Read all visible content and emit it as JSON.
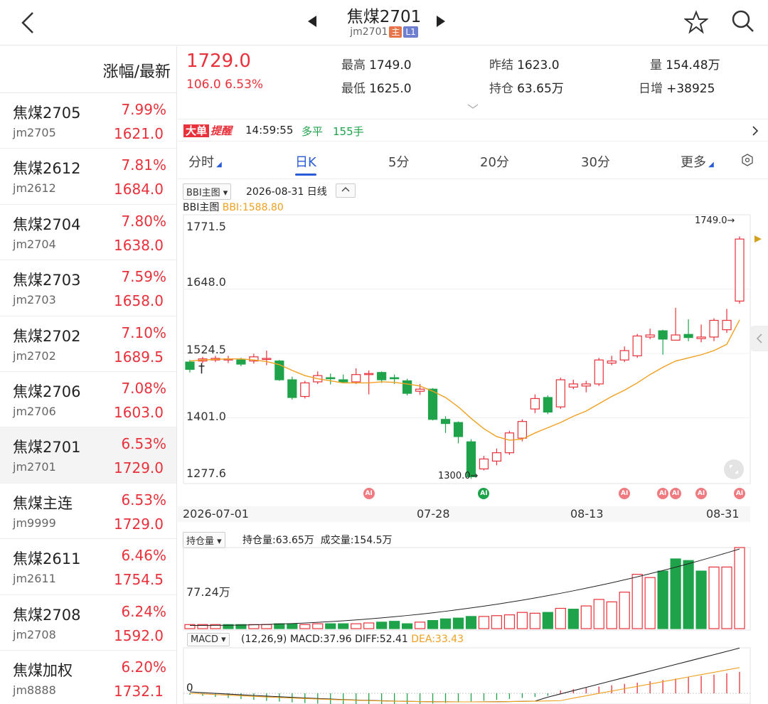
{
  "header": {
    "title": "焦煤2701",
    "code": "jm2701",
    "badge_main": "主",
    "badge_l1": "L1"
  },
  "list": {
    "header": "涨幅/最新",
    "items": [
      {
        "name": "焦煤2705",
        "code": "jm2705",
        "pct": "7.99%",
        "price": "1621.0"
      },
      {
        "name": "焦煤2612",
        "code": "jm2612",
        "pct": "7.81%",
        "price": "1684.0"
      },
      {
        "name": "焦煤2704",
        "code": "jm2704",
        "pct": "7.80%",
        "price": "1638.0"
      },
      {
        "name": "焦煤2703",
        "code": "jm2703",
        "pct": "7.59%",
        "price": "1658.0"
      },
      {
        "name": "焦煤2702",
        "code": "jm2702",
        "pct": "7.10%",
        "price": "1689.5"
      },
      {
        "name": "焦煤2706",
        "code": "jm2706",
        "pct": "7.08%",
        "price": "1603.0"
      },
      {
        "name": "焦煤2701",
        "code": "jm2701",
        "pct": "6.53%",
        "price": "1729.0"
      },
      {
        "name": "焦煤主连",
        "code": "jm9999",
        "pct": "6.53%",
        "price": "1729.0"
      },
      {
        "name": "焦煤2611",
        "code": "jm2611",
        "pct": "6.46%",
        "price": "1754.5"
      },
      {
        "name": "焦煤2708",
        "code": "jm2708",
        "pct": "6.24%",
        "price": "1592.0"
      },
      {
        "name": "焦煤加权",
        "code": "jm8888",
        "pct": "6.20%",
        "price": "1732.1"
      }
    ]
  },
  "quote": {
    "last": "1729.0",
    "change": "106.0",
    "change_pct": "6.53%",
    "high_label": "最高",
    "high": "1749.0",
    "low_label": "最低",
    "low": "1625.0",
    "prev_settle_label": "昨结",
    "prev_settle": "1623.0",
    "oi_label": "持仓",
    "oi": "63.65万",
    "vol_label": "量",
    "vol": "154.48万",
    "daily_inc_label": "日增",
    "daily_inc": "+38925"
  },
  "alert": {
    "tag1": "大单",
    "tag2": "提醒",
    "time": "14:59:55",
    "type": "多平",
    "qty": "155手"
  },
  "tabs": [
    "分时",
    "日K",
    "5分",
    "20分",
    "30分",
    "更多"
  ],
  "active_tab": 1,
  "colors": {
    "up": "#e8313a",
    "down": "#1ea34a",
    "ma": "#f0a020",
    "accent": "#2a5bd7"
  },
  "main_chart": {
    "indicator_select": "BBI主图",
    "date_label": "2026-08-31 日线",
    "legend_name": "BBI主图",
    "bbi_label": "BBI:1588.80",
    "yticks": [
      "1771.5",
      "1648.0",
      "1524.5",
      "1401.0",
      "1277.6"
    ],
    "max_marker": "1749.0",
    "min_marker": "1300.0",
    "xticks": [
      "2026-07-01",
      "07-28",
      "08-13",
      "08-31"
    ],
    "ai_label": "AI"
  },
  "oi_chart": {
    "indicator_select": "持仓量",
    "oi_label": "持仓量:63.65万",
    "vol_label": "成交量:154.5万",
    "ytick": "77.24万"
  },
  "macd_chart": {
    "indicator_select": "MACD",
    "params": "(12,26,9)",
    "macd": "MACD:37.96",
    "diff": "DIFF:52.41",
    "dea": "DEA:33.43",
    "zero_label": "0"
  },
  "chart_data": [
    {
      "type": "candlestick",
      "title": "焦煤2701 日K",
      "ylim": [
        1277.6,
        1771.5
      ],
      "x_first": "2026-07-01",
      "x_last": "2026-08-31",
      "candles": [
        {
          "o": 1508,
          "c": 1494,
          "h": 1512,
          "l": 1488
        },
        {
          "o": 1510,
          "c": 1514,
          "h": 1518,
          "l": 1506
        },
        {
          "o": 1512,
          "c": 1515,
          "h": 1520,
          "l": 1508
        },
        {
          "o": 1513,
          "c": 1514,
          "h": 1520,
          "l": 1506
        },
        {
          "o": 1512,
          "c": 1504,
          "h": 1516,
          "l": 1500
        },
        {
          "o": 1510,
          "c": 1518,
          "h": 1524,
          "l": 1505
        },
        {
          "o": 1515,
          "c": 1515,
          "h": 1530,
          "l": 1502
        },
        {
          "o": 1510,
          "c": 1474,
          "h": 1512,
          "l": 1472
        },
        {
          "o": 1474,
          "c": 1440,
          "h": 1480,
          "l": 1436
        },
        {
          "o": 1442,
          "c": 1468,
          "h": 1472,
          "l": 1438
        },
        {
          "o": 1470,
          "c": 1482,
          "h": 1490,
          "l": 1466
        },
        {
          "o": 1478,
          "c": 1476,
          "h": 1486,
          "l": 1465
        },
        {
          "o": 1474,
          "c": 1470,
          "h": 1484,
          "l": 1468
        },
        {
          "o": 1470,
          "c": 1484,
          "h": 1496,
          "l": 1466
        },
        {
          "o": 1484,
          "c": 1486,
          "h": 1492,
          "l": 1446
        },
        {
          "o": 1488,
          "c": 1474,
          "h": 1490,
          "l": 1468
        },
        {
          "o": 1478,
          "c": 1476,
          "h": 1484,
          "l": 1466
        },
        {
          "o": 1472,
          "c": 1448,
          "h": 1476,
          "l": 1444
        },
        {
          "o": 1452,
          "c": 1456,
          "h": 1466,
          "l": 1445
        },
        {
          "o": 1456,
          "c": 1398,
          "h": 1458,
          "l": 1396
        },
        {
          "o": 1398,
          "c": 1390,
          "h": 1404,
          "l": 1372
        },
        {
          "o": 1392,
          "c": 1365,
          "h": 1394,
          "l": 1352
        },
        {
          "o": 1355,
          "c": 1288,
          "h": 1360,
          "l": 1284
        },
        {
          "o": 1303,
          "c": 1322,
          "h": 1328,
          "l": 1300
        },
        {
          "o": 1318,
          "c": 1334,
          "h": 1342,
          "l": 1310
        },
        {
          "o": 1334,
          "c": 1372,
          "h": 1376,
          "l": 1330
        },
        {
          "o": 1362,
          "c": 1394,
          "h": 1398,
          "l": 1356
        },
        {
          "o": 1418,
          "c": 1438,
          "h": 1446,
          "l": 1410
        },
        {
          "o": 1440,
          "c": 1412,
          "h": 1444,
          "l": 1408
        },
        {
          "o": 1422,
          "c": 1474,
          "h": 1478,
          "l": 1418
        },
        {
          "o": 1460,
          "c": 1466,
          "h": 1474,
          "l": 1456
        },
        {
          "o": 1462,
          "c": 1466,
          "h": 1472,
          "l": 1450
        },
        {
          "o": 1466,
          "c": 1512,
          "h": 1516,
          "l": 1462
        },
        {
          "o": 1506,
          "c": 1510,
          "h": 1520,
          "l": 1502
        },
        {
          "o": 1512,
          "c": 1530,
          "h": 1538,
          "l": 1508
        },
        {
          "o": 1520,
          "c": 1558,
          "h": 1562,
          "l": 1516
        },
        {
          "o": 1556,
          "c": 1560,
          "h": 1572,
          "l": 1552
        },
        {
          "o": 1568,
          "c": 1552,
          "h": 1570,
          "l": 1522
        },
        {
          "o": 1550,
          "c": 1560,
          "h": 1612,
          "l": 1552
        },
        {
          "o": 1561,
          "c": 1555,
          "h": 1590,
          "l": 1548
        },
        {
          "o": 1553,
          "c": 1556,
          "h": 1580,
          "l": 1546
        },
        {
          "o": 1556,
          "c": 1588,
          "h": 1592,
          "l": 1548
        },
        {
          "o": 1570,
          "c": 1588,
          "h": 1610,
          "l": 1564
        },
        {
          "o": 1625,
          "c": 1744,
          "h": 1749,
          "l": 1620
        }
      ],
      "bbi": [
        1510,
        1512,
        1513,
        1514,
        1514,
        1512,
        1509,
        1503,
        1492,
        1482,
        1476,
        1472,
        1468,
        1468,
        1468,
        1470,
        1469,
        1466,
        1462,
        1452,
        1440,
        1422,
        1400,
        1380,
        1365,
        1358,
        1360,
        1372,
        1382,
        1392,
        1404,
        1414,
        1428,
        1442,
        1454,
        1468,
        1484,
        1498,
        1510,
        1516,
        1522,
        1530,
        1542,
        1588.8
      ],
      "bbi_name": "BBI"
    },
    {
      "type": "bar",
      "title": "持仓量/成交量",
      "ytick": "77.24万",
      "volumes": [
        0.05,
        0.05,
        0.05,
        0.05,
        0.05,
        0.05,
        0.05,
        0.06,
        0.06,
        0.05,
        0.06,
        0.06,
        0.06,
        0.06,
        0.07,
        0.08,
        0.09,
        0.06,
        0.08,
        0.1,
        0.12,
        0.13,
        0.15,
        0.15,
        0.16,
        0.17,
        0.2,
        0.19,
        0.2,
        0.25,
        0.24,
        0.28,
        0.36,
        0.33,
        0.45,
        0.67,
        0.63,
        0.71,
        0.86,
        0.84,
        0.71,
        0.76,
        0.76,
        1.0
      ],
      "up": [
        true,
        true,
        true,
        false,
        false,
        true,
        true,
        false,
        false,
        true,
        true,
        false,
        false,
        true,
        true,
        false,
        false,
        false,
        true,
        false,
        false,
        false,
        false,
        true,
        true,
        true,
        true,
        true,
        false,
        true,
        false,
        true,
        true,
        true,
        true,
        true,
        true,
        false,
        false,
        false,
        false,
        true,
        true,
        true
      ]
    },
    {
      "type": "bar",
      "title": "MACD",
      "legend": [
        "MACD:37.96",
        "DIFF:52.41",
        "DEA:33.43"
      ]
    }
  ]
}
